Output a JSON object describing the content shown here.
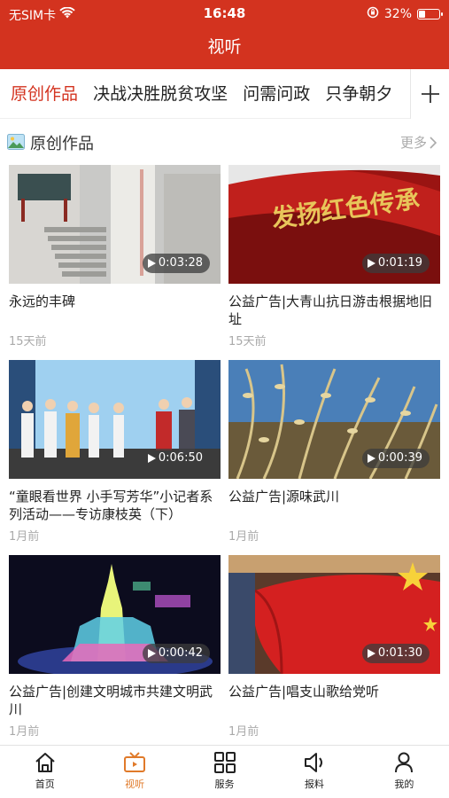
{
  "status_bar": {
    "carrier": "无SIM卡",
    "time": "16:48",
    "battery": "32%",
    "battery_level": 0.32
  },
  "header": {
    "title": "视听"
  },
  "tabs": [
    {
      "label": "原创作品",
      "active": true
    },
    {
      "label": "决战决胜脱贫攻坚",
      "active": false
    },
    {
      "label": "问需问政",
      "active": false
    },
    {
      "label": "只争朝夕",
      "active": false
    }
  ],
  "section": {
    "title": "原创作品",
    "more": "更多"
  },
  "videos": [
    {
      "title": "永远的丰碑",
      "duration": "0:03:28",
      "time": "15天前"
    },
    {
      "title": "公益广告|大青山抗日游击根据地旧址",
      "duration": "0:01:19",
      "time": "15天前"
    },
    {
      "title": "“童眼看世界 小手写芳华”小记者系列活动——专访康枝英（下）",
      "duration": "0:06:50",
      "time": "1月前"
    },
    {
      "title": "公益广告|源味武川",
      "duration": "0:00:39",
      "time": "1月前"
    },
    {
      "title": "公益广告|创建文明城市共建文明武川",
      "duration": "0:00:42",
      "time": "1月前"
    },
    {
      "title": "公益广告|唱支山歌给党听",
      "duration": "0:01:30",
      "time": "1月前"
    }
  ],
  "thumb_texts": {
    "banner": "发扬红色传承"
  },
  "bottom_nav": [
    {
      "label": "首页",
      "icon": "home-icon",
      "active": false
    },
    {
      "label": "视听",
      "icon": "tv-icon",
      "active": true
    },
    {
      "label": "服务",
      "icon": "grid-icon",
      "active": false
    },
    {
      "label": "报料",
      "icon": "speaker-icon",
      "active": false
    },
    {
      "label": "我的",
      "icon": "person-icon",
      "active": false
    }
  ],
  "colors": {
    "brand_red": "#d3331f",
    "active_nav": "#e07a2a",
    "muted": "#aaaaaa"
  }
}
